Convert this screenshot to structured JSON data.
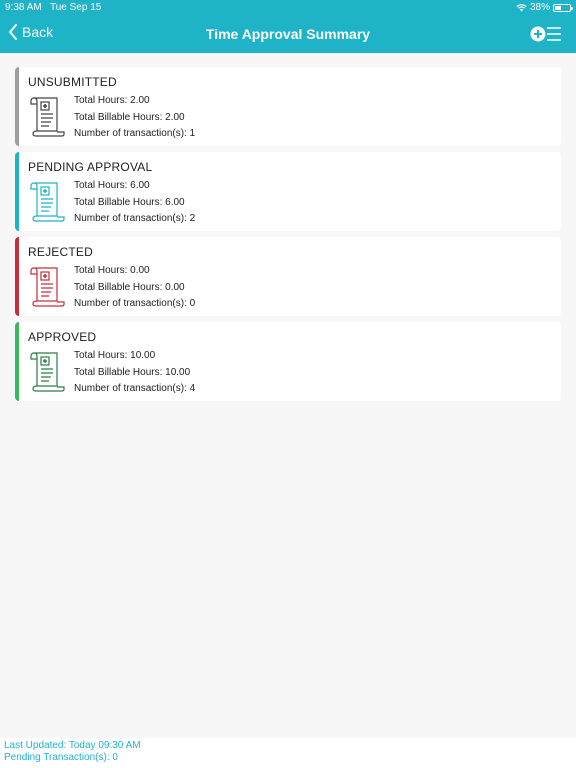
{
  "status_bar": {
    "time": "9:38 AM",
    "date": "Tue Sep 15",
    "battery": "38%"
  },
  "nav": {
    "back_label": "Back",
    "title": "Time Approval Summary"
  },
  "cards": [
    {
      "title": "UNSUBMITTED",
      "color": "#9e9e9e",
      "total_hours": "Total Hours:  2.00",
      "billable_hours": "Total Billable Hours:  2.00",
      "transactions": "Number of transaction(s):  1"
    },
    {
      "title": "PENDING APPROVAL",
      "color": "#1fb3c8",
      "total_hours": "Total Hours:  6.00",
      "billable_hours": "Total Billable Hours:  6.00",
      "transactions": "Number of transaction(s):  2"
    },
    {
      "title": "REJECTED",
      "color": "#c62d3a",
      "total_hours": "Total Hours:  0.00",
      "billable_hours": "Total Billable Hours:  0.00",
      "transactions": "Number of transaction(s):  0"
    },
    {
      "title": "APPROVED",
      "color": "#3cb85c",
      "total_hours": "Total Hours:  10.00",
      "billable_hours": "Total Billable Hours:  10.00",
      "transactions": "Number of transaction(s):  4"
    }
  ],
  "footer": {
    "last_updated": "Last Updated: Today 09:30 AM",
    "pending": "Pending Transaction(s): 0"
  }
}
